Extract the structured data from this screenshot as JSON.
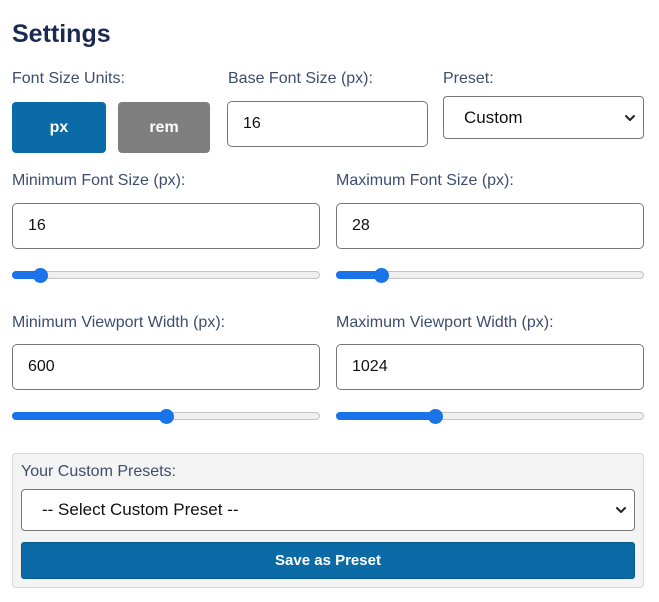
{
  "title": "Settings",
  "units": {
    "label": "Font Size Units:",
    "options": [
      "px",
      "rem"
    ],
    "selected": "px"
  },
  "base_font": {
    "label": "Base Font Size (px):",
    "value": "16"
  },
  "preset": {
    "label": "Preset:",
    "selected": "Custom"
  },
  "min_font": {
    "label": "Minimum Font Size (px):",
    "value": "16",
    "slider_fraction": 0.09
  },
  "max_font": {
    "label": "Maximum Font Size (px):",
    "value": "28",
    "slider_fraction": 0.146
  },
  "min_viewport": {
    "label": "Minimum Viewport Width (px):",
    "value": "600",
    "slider_fraction": 0.5
  },
  "max_viewport": {
    "label": "Maximum Viewport Width (px):",
    "value": "1024",
    "slider_fraction": 0.32
  },
  "custom_presets": {
    "label": "Your Custom Presets:",
    "select_placeholder": "-- Select Custom Preset --",
    "save_label": "Save as Preset"
  },
  "colors": {
    "accent": "#0b6ba6",
    "inactive_button": "#7f7f7f",
    "slider": "#1a73e8",
    "heading": "#1c2a52"
  }
}
